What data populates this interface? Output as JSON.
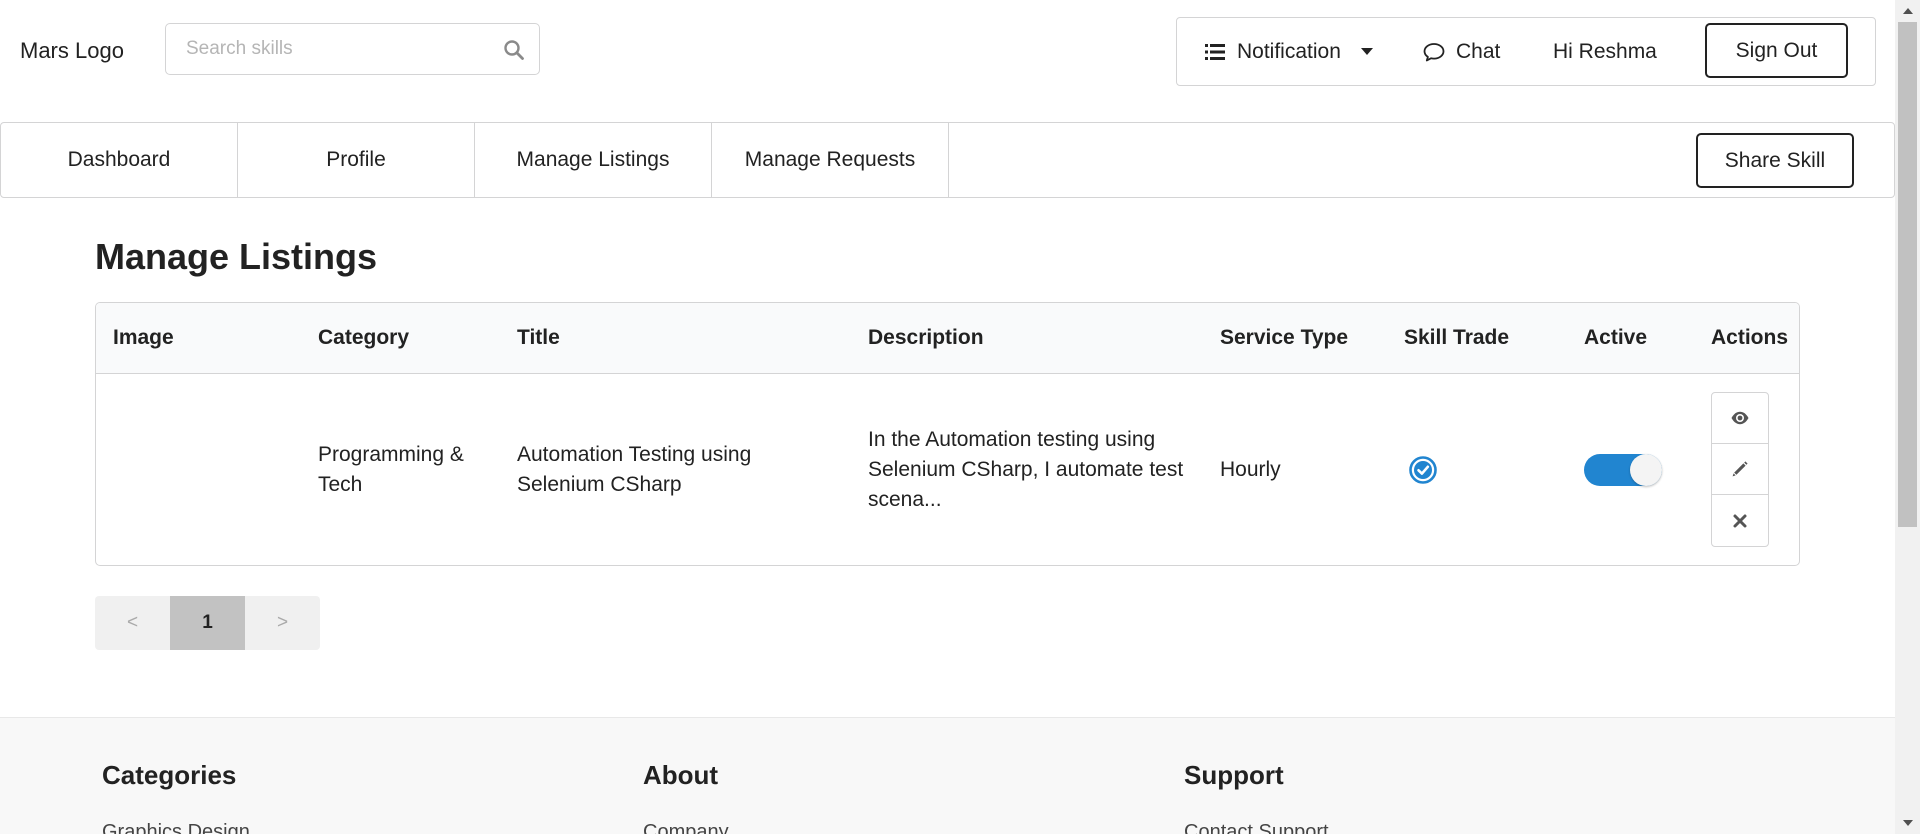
{
  "app": {
    "logo": "Mars Logo"
  },
  "search": {
    "placeholder": "Search skills",
    "value": ""
  },
  "top_menu": {
    "notification_label": "Notification",
    "chat_label": "Chat",
    "greeting": "Hi Reshma",
    "signout_label": "Sign Out"
  },
  "nav": {
    "tabs": [
      {
        "label": "Dashboard"
      },
      {
        "label": "Profile"
      },
      {
        "label": "Manage Listings"
      },
      {
        "label": "Manage Requests"
      }
    ],
    "share_label": "Share Skill"
  },
  "page": {
    "title": "Manage Listings"
  },
  "table": {
    "columns": [
      "Image",
      "Category",
      "Title",
      "Description",
      "Service Type",
      "Skill Trade",
      "Active",
      "Actions"
    ],
    "rows": [
      {
        "image": "",
        "category": "Programming & Tech",
        "title": "Automation Testing using Selenium CSharp",
        "description": "In the Automation testing using Selenium CSharp, I automate test scena...",
        "service_type": "Hourly",
        "skill_trade": "checked",
        "active": true,
        "actions": [
          "eye-icon",
          "pencil-icon",
          "close-icon"
        ]
      }
    ]
  },
  "pagination": {
    "prev": "<",
    "current": "1",
    "next": ">"
  },
  "footer": {
    "columns": [
      {
        "heading": "Categories",
        "first_link": "Graphics Design"
      },
      {
        "heading": "About",
        "first_link": "Company"
      },
      {
        "heading": "Support",
        "first_link": "Contact Support"
      }
    ]
  },
  "colors": {
    "accent": "#2185d0",
    "border": "#d4d4d5",
    "header_bg": "#f9fafb",
    "footer_bg": "#f8f8f8",
    "active_page_bg": "#c2c2c2"
  }
}
